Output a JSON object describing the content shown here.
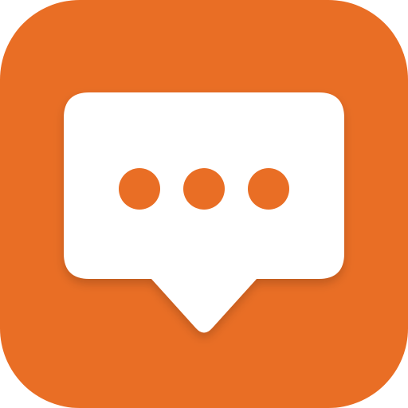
{
  "app_icon": {
    "icon_name": "chat-bubble-ellipsis-icon",
    "colors": {
      "background": "#E96E25",
      "bubble": "#FFFFFF",
      "dots": "#E96E25"
    },
    "typing_indicator_dot_count": 3
  }
}
